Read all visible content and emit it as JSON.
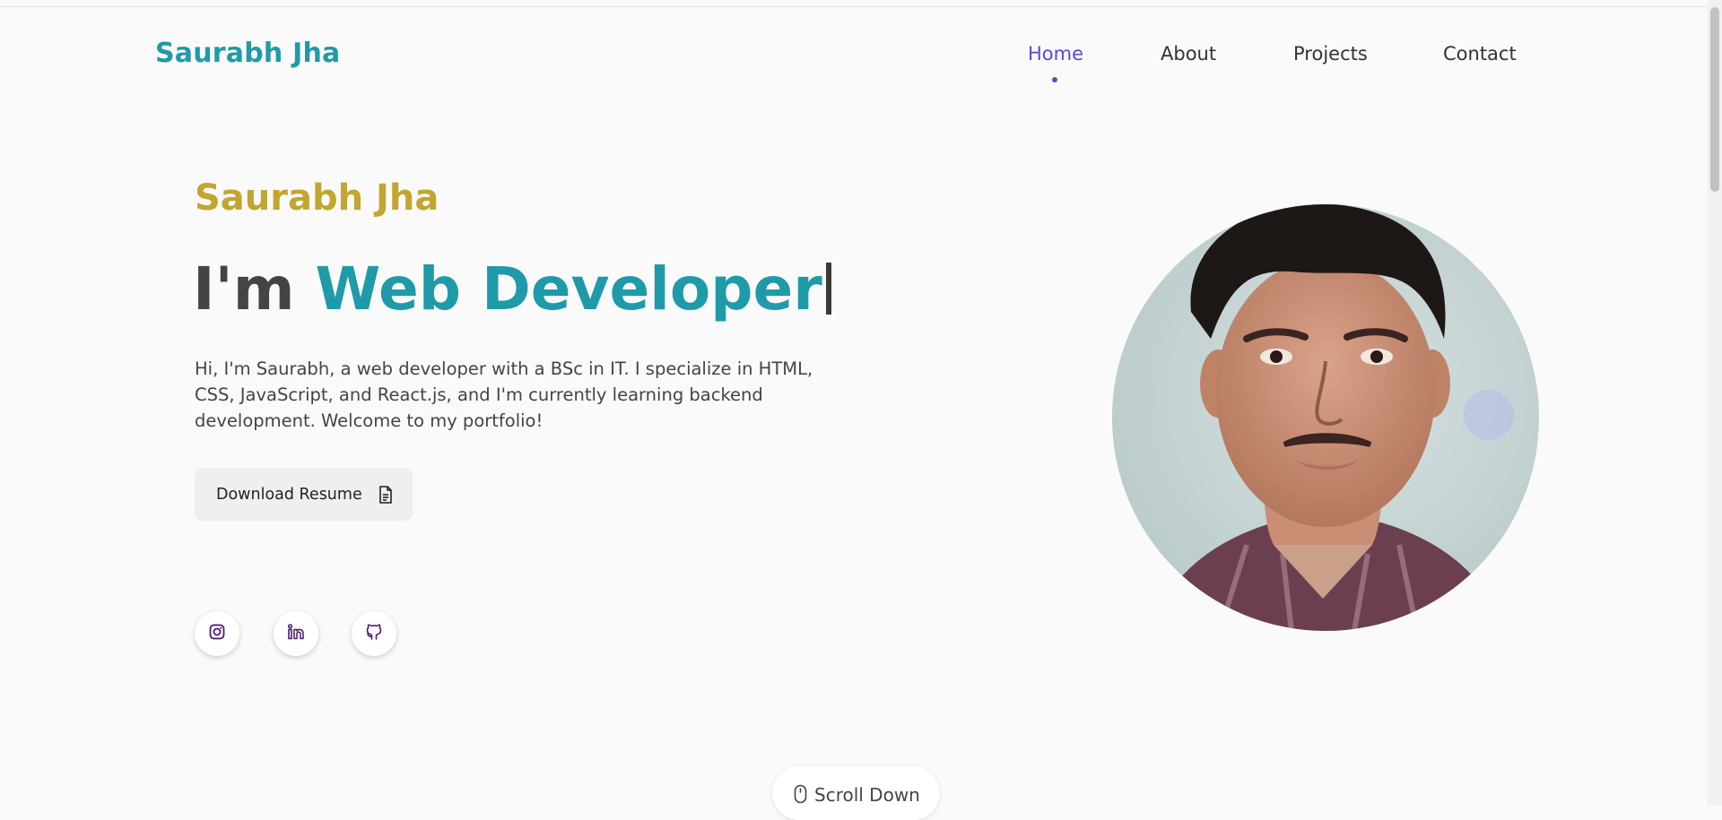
{
  "header": {
    "brand": "Saurabh Jha",
    "nav": [
      {
        "label": "Home",
        "active": true
      },
      {
        "label": "About",
        "active": false
      },
      {
        "label": "Projects",
        "active": false
      },
      {
        "label": "Contact",
        "active": false
      }
    ]
  },
  "hero": {
    "name": "Saurabh Jha",
    "title_prefix": "I'm",
    "title_role": "Web Developer",
    "description": "Hi, I'm Saurabh, a web developer with a BSc in IT. I specialize in HTML, CSS, JavaScript, and React.js, and I'm currently learning backend development. Welcome to my portfolio!",
    "resume_button": "Download Resume",
    "resume_icon": "document-icon",
    "social_icons": [
      "instagram-icon",
      "linkedin-icon",
      "github-icon"
    ],
    "profile_photo": "profile-photo"
  },
  "scroll_down": {
    "label": "Scroll Down",
    "icon": "mouse-icon"
  },
  "colors": {
    "brand": "#1f9aa8",
    "name_accent": "#c3a52f",
    "nav_active": "#5a4bd0",
    "icon_purple": "#4a1a6e"
  }
}
